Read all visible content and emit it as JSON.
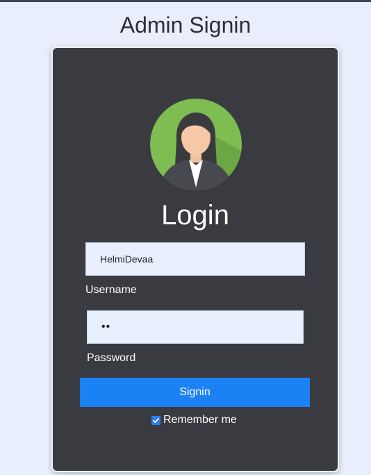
{
  "page": {
    "title": "Admin Signin"
  },
  "login_card": {
    "heading": "Login",
    "username": {
      "value": "HelmiDevaa",
      "label": "Username"
    },
    "password": {
      "masked_value": "••",
      "label": "Password"
    },
    "signin_button_label": "Signin",
    "remember_me": {
      "label": "Remember me",
      "checked": true
    }
  },
  "colors": {
    "page_background": "#e8eefc",
    "card_background": "#3a3b40",
    "button_background": "#1a82f5",
    "input_background": "#e8f0fe"
  },
  "icons": {
    "avatar": "female-user-avatar-icon",
    "checkbox": "checkmark-icon"
  }
}
